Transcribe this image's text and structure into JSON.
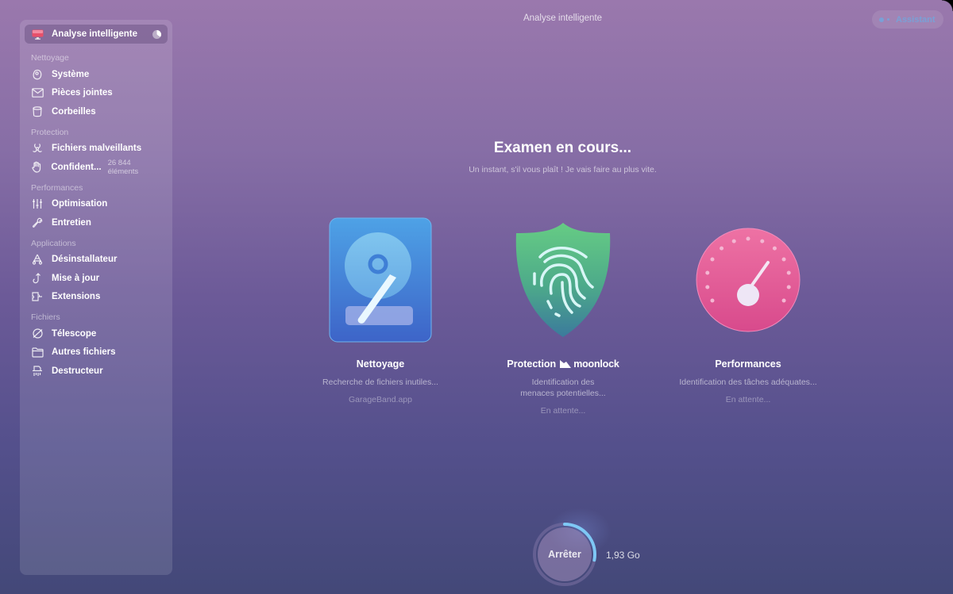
{
  "window": {
    "title": "Analyse intelligente",
    "assistant_label": "Assistant"
  },
  "sidebar": {
    "active": {
      "label": "Analyse intelligente",
      "icon": "monitor-icon"
    },
    "sections": [
      {
        "title": "Nettoyage",
        "items": [
          {
            "label": "Système",
            "icon": "disk-icon"
          },
          {
            "label": "Pièces jointes",
            "icon": "envelope-icon"
          },
          {
            "label": "Corbeilles",
            "icon": "trash-bin-icon"
          }
        ]
      },
      {
        "title": "Protection",
        "items": [
          {
            "label": "Fichiers malveillants",
            "icon": "biohazard-icon"
          },
          {
            "label": "Confident...",
            "icon": "hand-icon",
            "count": "26 844 éléments"
          }
        ]
      },
      {
        "title": "Performances",
        "items": [
          {
            "label": "Optimisation",
            "icon": "sliders-icon"
          },
          {
            "label": "Entretien",
            "icon": "wrench-icon"
          }
        ]
      },
      {
        "title": "Applications",
        "items": [
          {
            "label": "Désinstallateur",
            "icon": "uninstaller-icon"
          },
          {
            "label": "Mise à jour",
            "icon": "update-icon"
          },
          {
            "label": "Extensions",
            "icon": "puzzle-icon"
          }
        ]
      },
      {
        "title": "Fichiers",
        "items": [
          {
            "label": "Télescope",
            "icon": "planet-icon"
          },
          {
            "label": "Autres fichiers",
            "icon": "folder-icon"
          },
          {
            "label": "Destructeur",
            "icon": "shredder-icon"
          }
        ]
      }
    ]
  },
  "main": {
    "heading": "Examen en cours...",
    "subheading": "Un instant, s'il vous plaît ! Je vais faire au plus vite.",
    "modules": [
      {
        "name": "Nettoyage",
        "description": "Recherche de fichiers inutiles...",
        "status": "GarageBand.app",
        "icon": "hard-drive-icon"
      },
      {
        "name": "Protection",
        "brand": "moonlock",
        "description": "Identification des menaces potentielles...",
        "status": "En attente...",
        "icon": "fingerprint-shield-icon"
      },
      {
        "name": "Performances",
        "description": "Identification des tâches adéquates...",
        "status": "En attente...",
        "icon": "speedometer-icon"
      }
    ],
    "stop": {
      "label": "Arrêter",
      "size": "1,93 Go",
      "progress": 0.28
    }
  },
  "colors": {
    "accent_blue": "#7aa0d6",
    "progress_ring": "#7ec8f5",
    "cleanup": "#3f7fd6",
    "protection": "#5cc98a",
    "performance": "#e4609a"
  }
}
